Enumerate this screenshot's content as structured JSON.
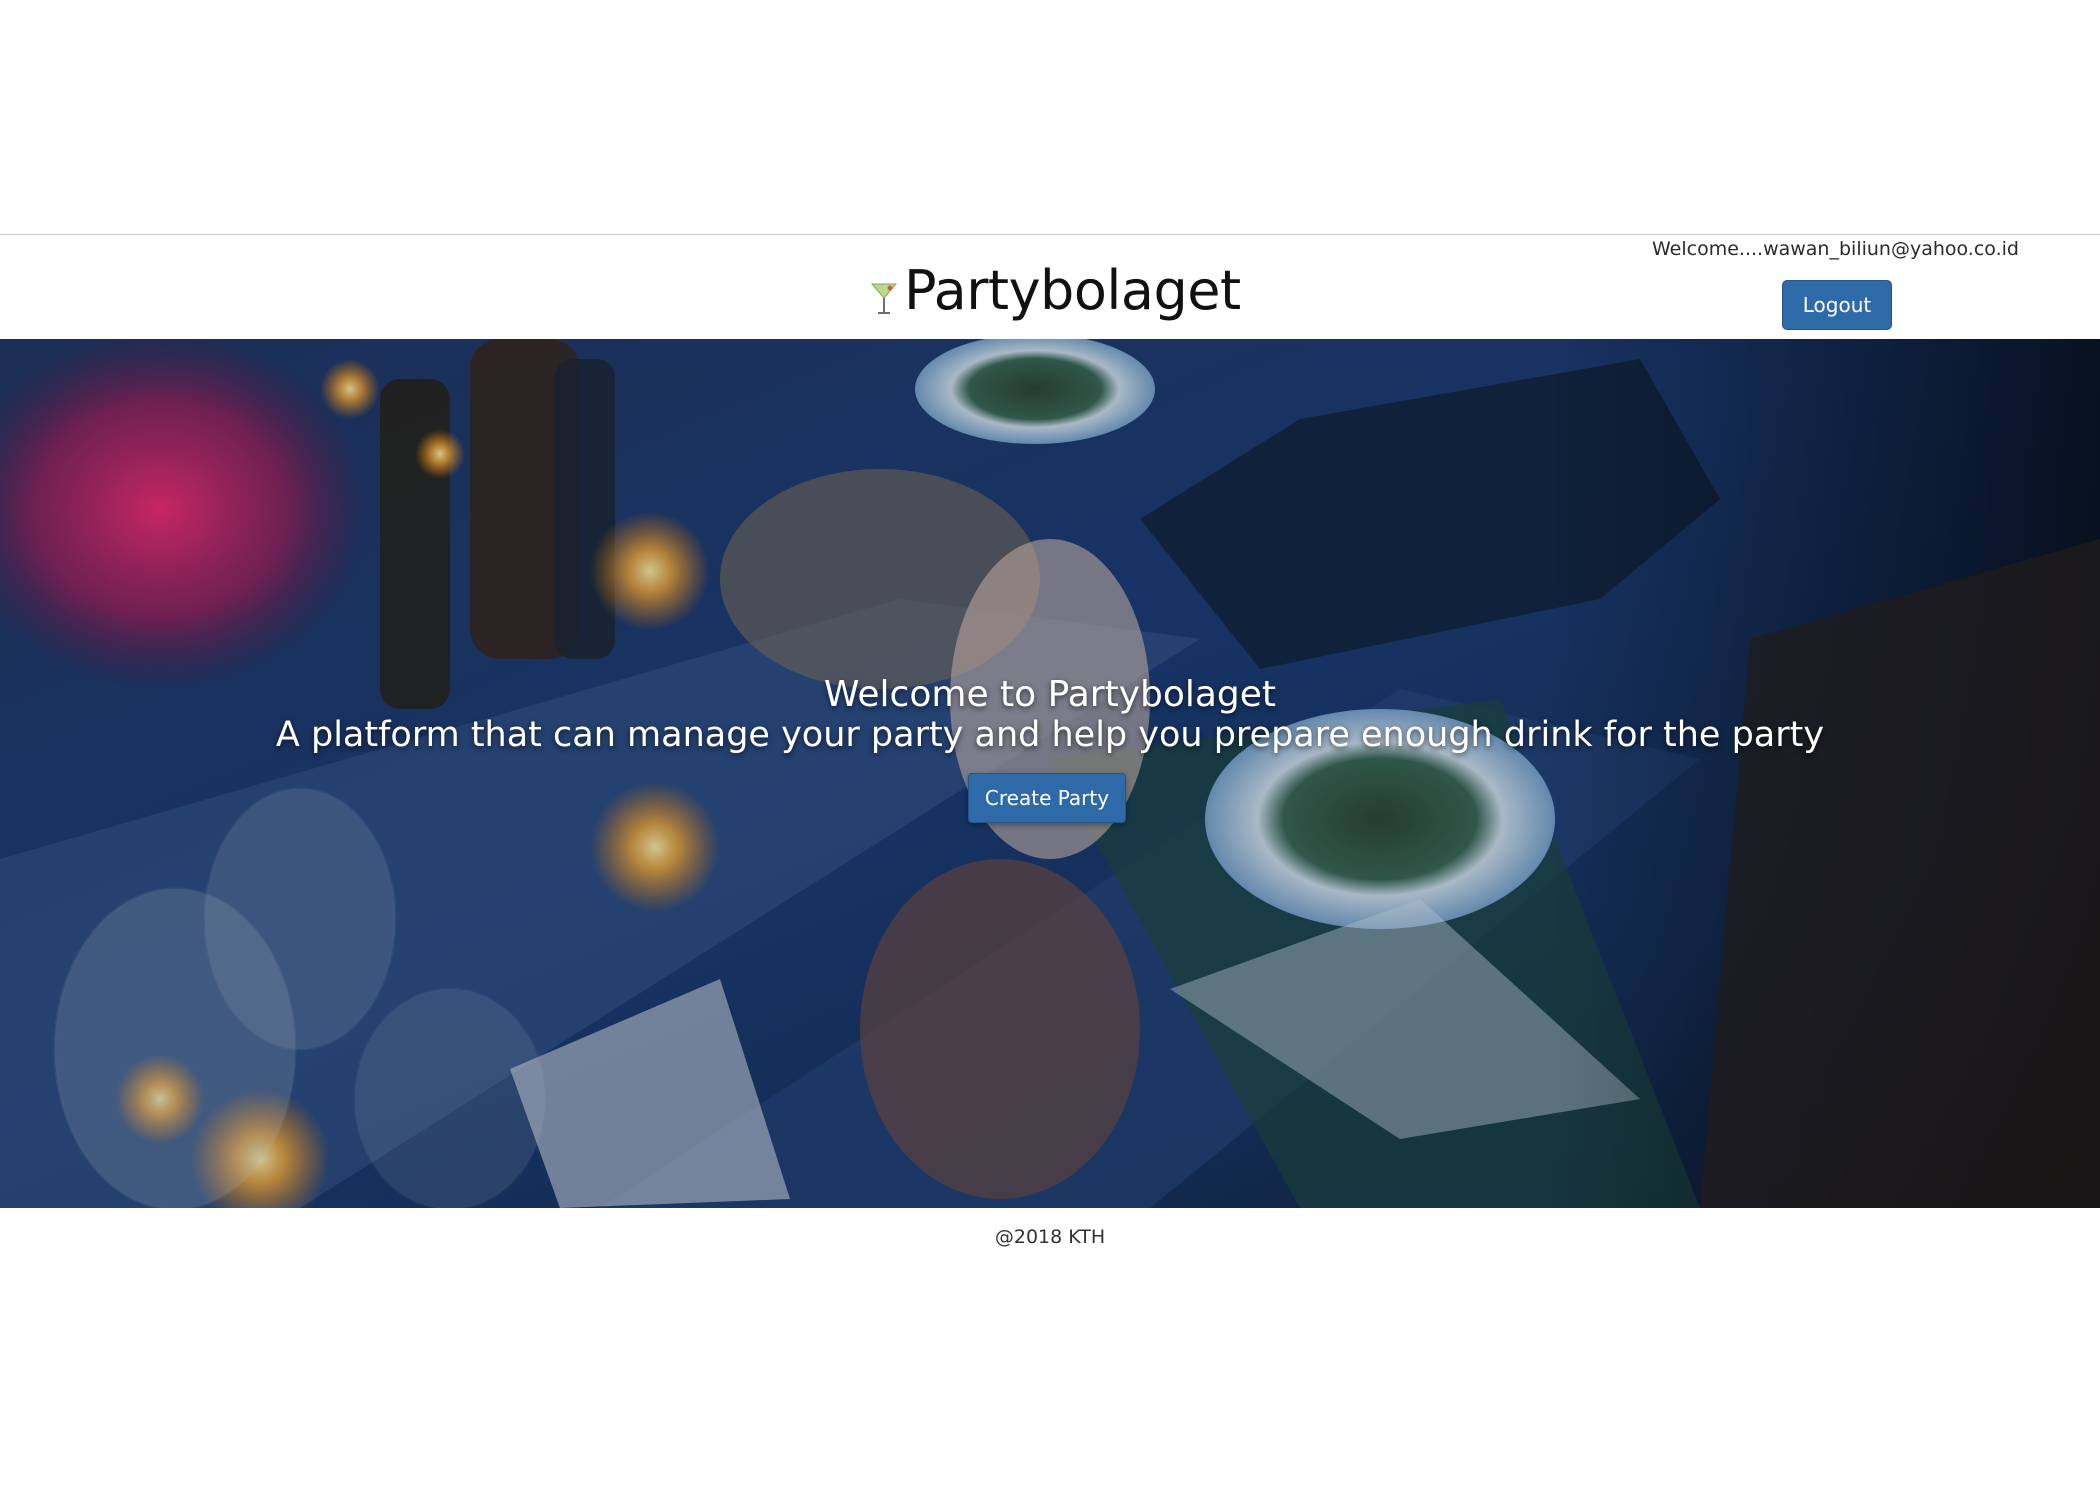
{
  "header": {
    "brand_title": "Partybolaget",
    "brand_icon": "cocktail-glass-icon",
    "welcome_text": "Welcome....wawan_biliun@yahoo.co.id",
    "logout_label": "Logout"
  },
  "hero": {
    "title": "Welcome to Partybolaget",
    "subtitle": "A platform that can manage your party and help you prepare enough drink for the party",
    "create_party_label": "Create Party",
    "background_image": "dinner party table with candles, wine glasses and champagne being poured"
  },
  "footer": {
    "copyright": "@2018 KTH"
  },
  "colors": {
    "primary_button": "#2f6aa8",
    "page_background": "#ffffff",
    "text_dark": "#111111"
  }
}
